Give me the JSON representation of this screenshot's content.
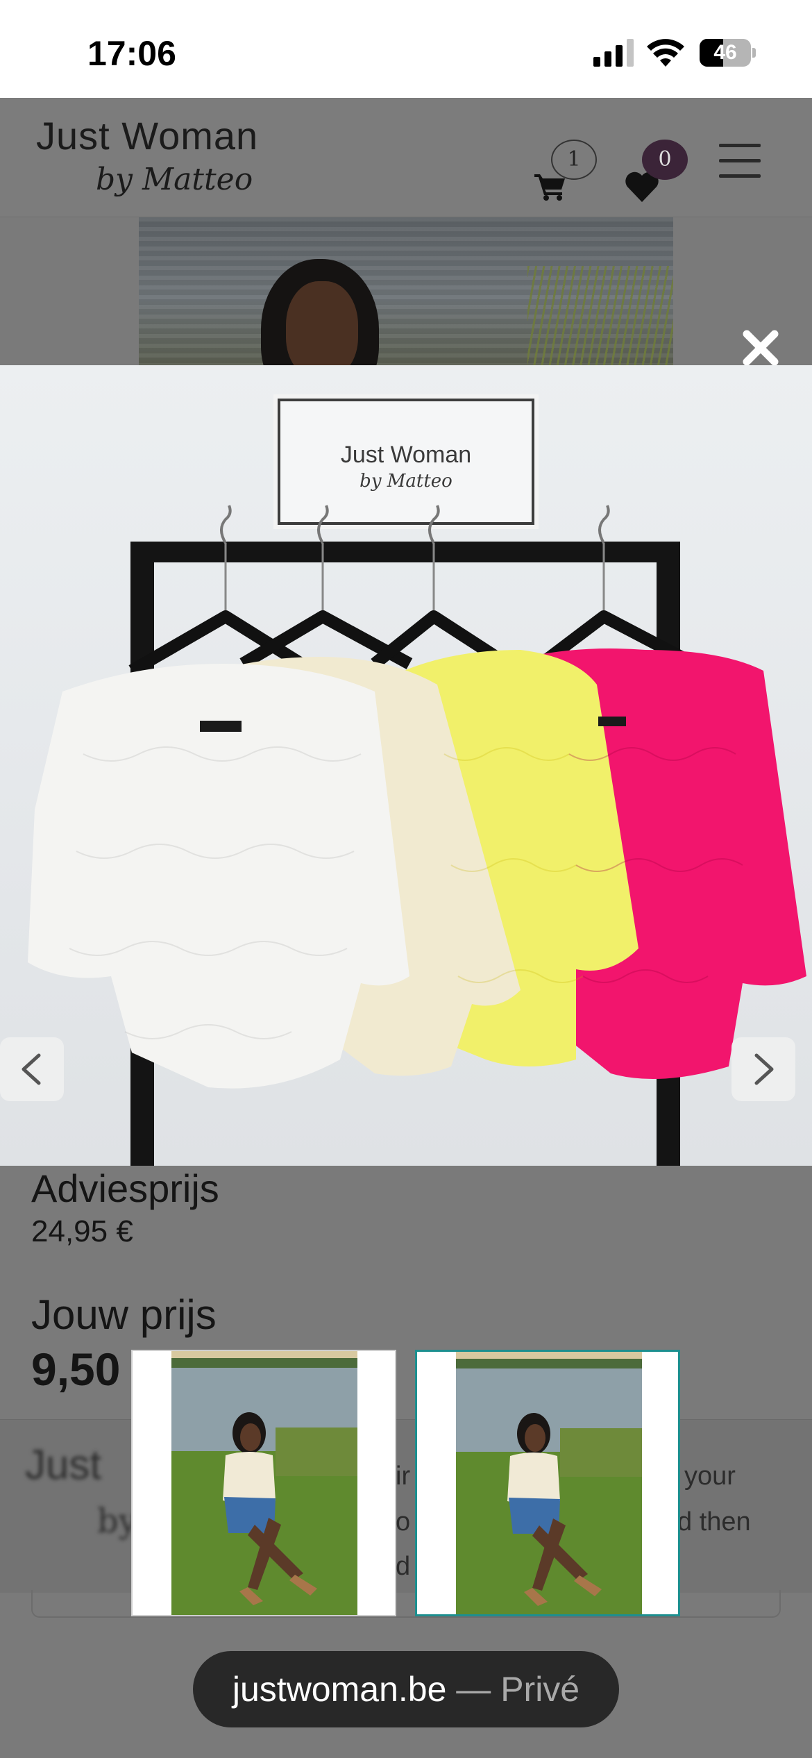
{
  "status_bar": {
    "time": "17:06",
    "battery_level": "46",
    "battery_fraction": 0.46,
    "icons": [
      "signal-icon",
      "wifi-icon",
      "battery-icon"
    ]
  },
  "header": {
    "logo_main": "Just Woman",
    "logo_sub": "by Matteo",
    "cart_count": "1",
    "wishlist_count": "0",
    "icons": [
      "cart-icon",
      "heart-icon",
      "menu-icon"
    ]
  },
  "lightbox": {
    "close_icon": "close-icon",
    "sign_main": "Just Woman",
    "sign_sub": "by Matteo",
    "prev_icon": "chevron-left-icon",
    "next_icon": "chevron-right-icon",
    "thumbnail_count": 2,
    "selected_thumbnail": 2
  },
  "product": {
    "advies_label": "Adviesprijs",
    "advies_value": "24,95 €",
    "jouw_label": "Jouw prijs",
    "jouw_value": "9,50"
  },
  "cookie_banner": {
    "logo_main": "Just",
    "logo_sub": "by",
    "fragment_a": "ir",
    "fragment_b": "o",
    "fragment_c": "d",
    "text_right_1": "your",
    "text_right_2": "d then"
  },
  "browser": {
    "domain": "justwoman.be",
    "separator": " — ",
    "mode": "Privé"
  },
  "colors": {
    "wishlist_badge": "#3b2438",
    "thumbnail_selected_border": "#1d8f8f",
    "blouse_white": "#f4f4f2",
    "blouse_cream": "#f1ead0",
    "blouse_yellow": "#f1f06a",
    "blouse_pink": "#f2156d"
  }
}
